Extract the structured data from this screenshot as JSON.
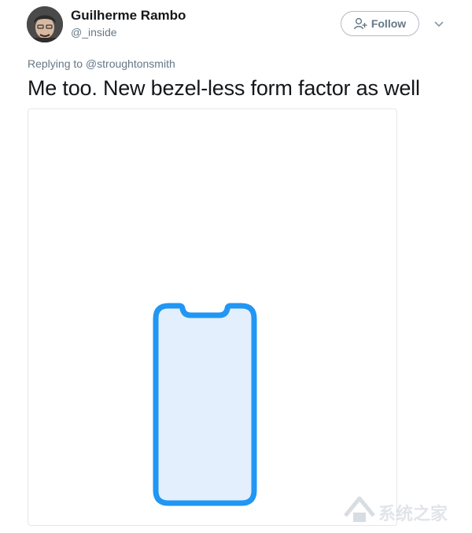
{
  "author": {
    "display_name": "Guilherme Rambo",
    "handle": "@_inside"
  },
  "follow_button": {
    "label": "Follow",
    "icon": "add-user-icon"
  },
  "more_menu_icon": "chevron-down-icon",
  "reply_context": "Replying to @stroughtonsmith",
  "tweet_text": "Me too. New bezel-less form factor as well",
  "media": {
    "icon": "phone-outline-icon",
    "colors": {
      "phone_stroke": "#2196f3",
      "phone_fill": "#e3effc"
    }
  },
  "watermark": {
    "text": "系统之家"
  },
  "colors": {
    "text_primary": "#14171a",
    "text_secondary": "#657786",
    "border": "#e1e8ed"
  }
}
